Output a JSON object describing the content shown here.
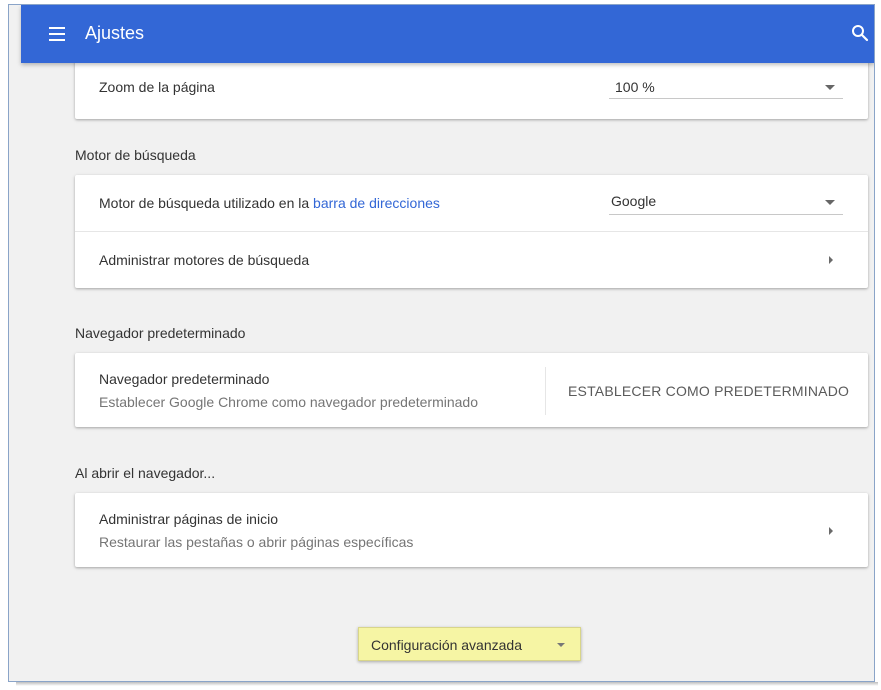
{
  "header": {
    "title": "Ajustes",
    "menu_icon": "hamburger-menu-icon",
    "search_icon": "search-icon",
    "bar_color": "#3367d6"
  },
  "appearance": {
    "zoom_label": "Zoom de la página",
    "zoom_value": "100 %"
  },
  "search_engine": {
    "section_title": "Motor de búsqueda",
    "used_in_prefix": "Motor de búsqueda utilizado en la ",
    "used_in_link": "barra de direcciones",
    "selected_engine": "Google",
    "manage_label": "Administrar motores de búsqueda"
  },
  "default_browser": {
    "section_title": "Navegador predeterminado",
    "title": "Navegador predeterminado",
    "subtitle": "Establecer Google Chrome como navegador predeterminado",
    "action_label": "ESTABLECER COMO PREDETERMINADO"
  },
  "on_startup": {
    "section_title": "Al abrir el navegador...",
    "title": "Administrar páginas de inicio",
    "subtitle": "Restaurar las pestañas o abrir páginas específicas"
  },
  "advanced": {
    "label": "Configuración avanzada",
    "highlight_color": "#f6f5a4"
  }
}
